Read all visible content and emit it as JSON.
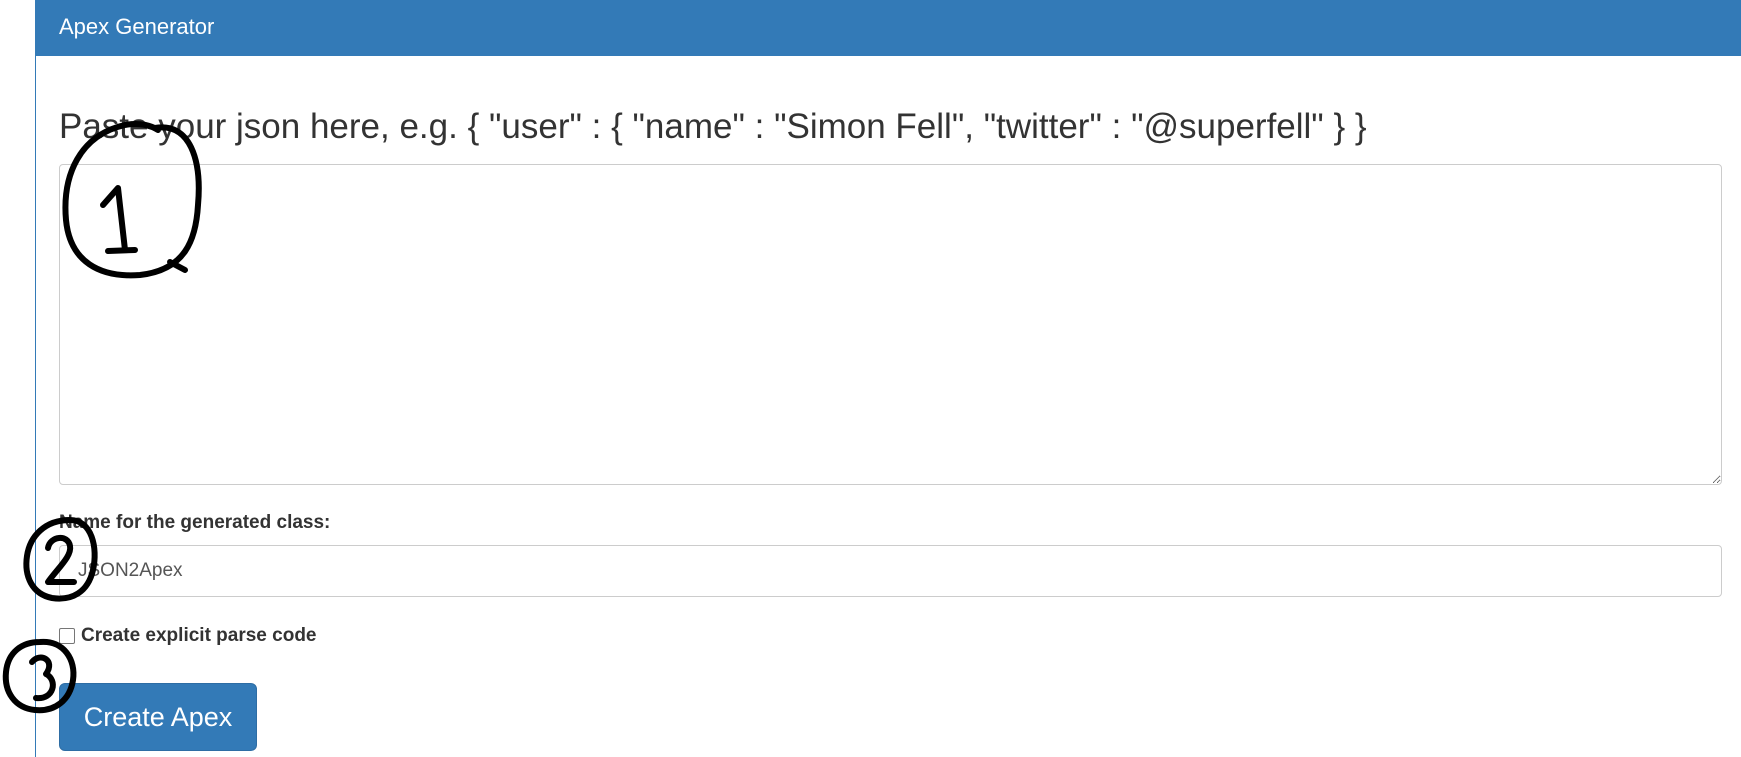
{
  "panel": {
    "title": "Apex Generator"
  },
  "json_input": {
    "label": "Paste your json here, e.g. { \"user\" : { \"name\" : \"Simon Fell\", \"twitter\" : \"@superfell\" } }",
    "value": ""
  },
  "class_name": {
    "label": "Name for the generated class:",
    "value": "JSON2Apex"
  },
  "explicit_parse": {
    "label": "Create explicit parse code",
    "checked": false
  },
  "submit": {
    "label": "Create Apex"
  },
  "annotations": {
    "markers": [
      "1",
      "2",
      "3"
    ],
    "color": "#000000"
  },
  "colors": {
    "primary": "#337ab7",
    "border": "#cccccc",
    "text": "#333333"
  }
}
